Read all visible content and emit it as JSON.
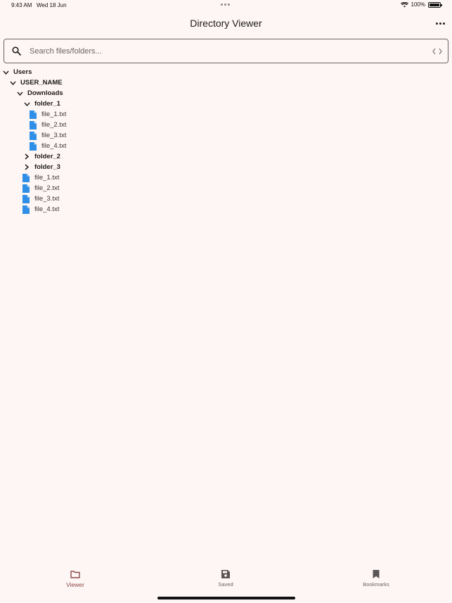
{
  "status_bar": {
    "time": "9:43 AM",
    "date": "Wed 18 Jun",
    "battery": "100%"
  },
  "header": {
    "title": "Directory Viewer"
  },
  "search": {
    "placeholder": "Search files/folders..."
  },
  "tree": {
    "users": "Users",
    "user_name": "USER_NAME",
    "downloads": "Downloads",
    "folder_1": "folder_1",
    "folder_1_files": [
      "file_1.txt",
      "file_2.txt",
      "file_3.txt",
      "file_4.txt"
    ],
    "folder_2": "folder_2",
    "folder_3": "folder_3",
    "downloads_files": [
      "file_1.txt",
      "file_2.txt",
      "file_3.txt",
      "file_4.txt"
    ]
  },
  "bottom_nav": {
    "viewer": "Viewer",
    "saved": "Saved",
    "bookmarks": "Bookmarks"
  },
  "colors": {
    "background": "#fdf6f4",
    "file_icon": "#2f8fe6",
    "active_nav": "#8b4a4a"
  }
}
